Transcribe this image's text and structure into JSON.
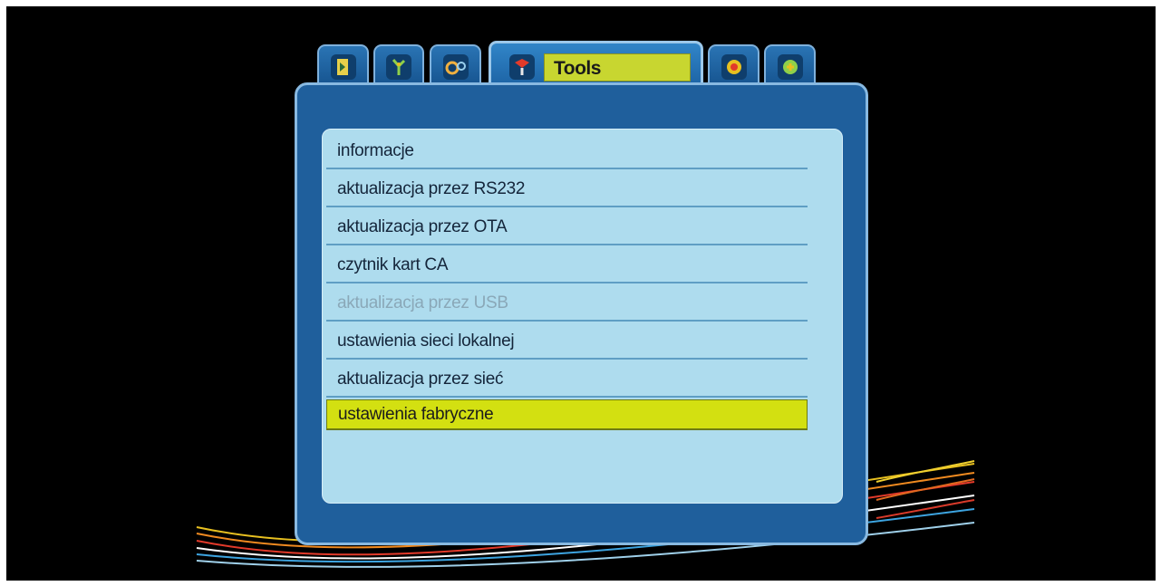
{
  "tabs": [
    {
      "icon": "installation-icon",
      "active": false
    },
    {
      "icon": "channel-icon",
      "active": false
    },
    {
      "icon": "settings-icon",
      "active": false
    },
    {
      "icon": "tools-icon",
      "active": true,
      "label": "Tools"
    },
    {
      "icon": "games-icon",
      "active": false
    },
    {
      "icon": "media-icon",
      "active": false
    }
  ],
  "menu": {
    "items": [
      {
        "label": "informacje",
        "state": "normal"
      },
      {
        "label": "aktualizacja przez RS232",
        "state": "normal"
      },
      {
        "label": "aktualizacja przez OTA",
        "state": "normal"
      },
      {
        "label": "czytnik kart CA",
        "state": "normal"
      },
      {
        "label": "aktualizacja przez USB",
        "state": "disabled"
      },
      {
        "label": "ustawienia sieci lokalnej",
        "state": "normal"
      },
      {
        "label": "aktualizacja przez sieć",
        "state": "normal"
      },
      {
        "label": "ustawienia fabryczne",
        "state": "selected"
      }
    ]
  },
  "colors": {
    "screen_bg": "#000000",
    "window_bg": "#1f5f9c",
    "panel_bg": "#aedcee",
    "highlight": "#d3e011",
    "disabled_text": "#8aa8b8"
  }
}
